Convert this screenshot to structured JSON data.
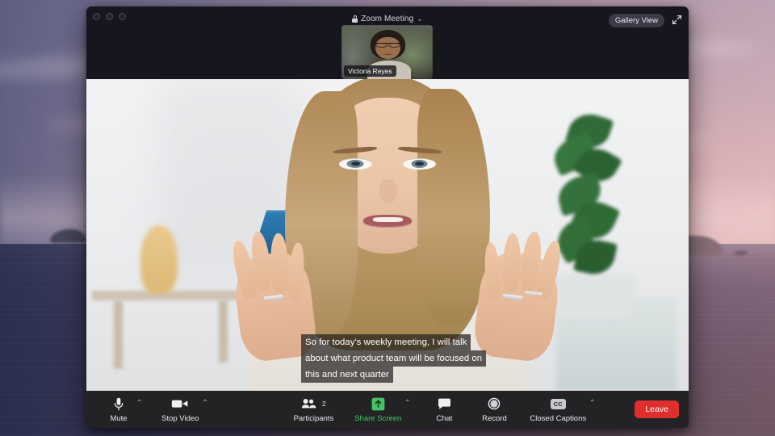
{
  "desktop": {
    "wallpaper_name": "dusk-seascape-wallpaper",
    "sky_color": "#a192ab",
    "sea_color": "#3c3c60"
  },
  "window": {
    "title": "Zoom Meeting",
    "lock_icon": "lock-icon",
    "title_caret": "⌄",
    "traffic_lights": [
      "close",
      "minimize",
      "maximize"
    ],
    "gallery_view_label": "Gallery View",
    "fullscreen_icon": "expand-arrows-icon"
  },
  "self_view": {
    "participant_name": "Victoria Reyes"
  },
  "main_video": {
    "speaker_label": "",
    "captions": [
      "So for today's weekly meeting, I will talk",
      "about what product team will be focused on",
      "this and next quarter"
    ]
  },
  "toolbar": {
    "accent_green": "#43c463",
    "leave_color": "#e02d2d",
    "items": [
      {
        "label": "Mute",
        "icon": "microphone-icon",
        "caret": "⌃",
        "badge": ""
      },
      {
        "label": "Stop Video",
        "icon": "video-camera-icon",
        "caret": "⌃",
        "badge": ""
      },
      {
        "label": "Participants",
        "icon": "people-icon",
        "caret": "",
        "badge": "2"
      },
      {
        "label": "Share Screen",
        "icon": "share-screen-icon",
        "caret": "⌃",
        "badge": ""
      },
      {
        "label": "Chat",
        "icon": "chat-bubble-icon",
        "caret": "",
        "badge": ""
      },
      {
        "label": "Record",
        "icon": "record-circle-icon",
        "caret": "",
        "badge": ""
      },
      {
        "label": "Closed Captions",
        "icon": "closed-captions-icon",
        "caret": "⌃",
        "badge": ""
      }
    ],
    "cc_badge_text": "CC",
    "leave_label": "Leave"
  }
}
